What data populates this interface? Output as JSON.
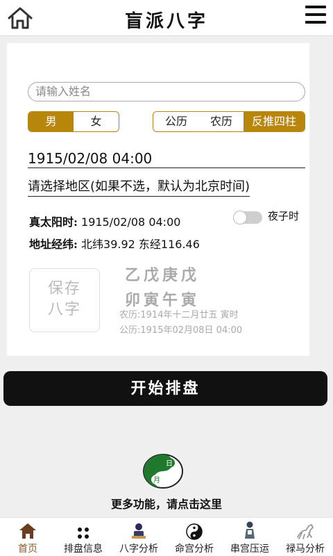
{
  "header": {
    "title": "盲派八字",
    "home_icon": "home-icon",
    "menu_icon": "menu-icon"
  },
  "form": {
    "name_placeholder": "请输入姓名",
    "gender_options": [
      "男",
      "女"
    ],
    "gender_selected": "男",
    "calendar_options": [
      "公历",
      "农历",
      "反推四柱"
    ],
    "calendar_selected": "反推四柱",
    "datetime": "1915/02/08 04:00",
    "region_prompt": "请选择地区(如果不选，默认为北京时间)"
  },
  "info": {
    "solar_label": "真太阳时:",
    "solar_value": "1915/02/08 04:00",
    "night_label": "夜子时",
    "night_toggle_on": false,
    "addr_label": "地址经纬:",
    "addr_value": "北纬39.92 东经116.46"
  },
  "save": {
    "line1": "保存",
    "line2": "八字"
  },
  "bazi": {
    "stems": "乙戊庚戊",
    "branches": "卯寅午寅",
    "lunar": "农历:1914年十二月廿五  寅时",
    "solar": "公历:1915年02月08日 04:00"
  },
  "start_button": "开始排盘",
  "more": {
    "logo_sun": "日",
    "logo_moon": "月",
    "text": "更多功能，请点击这里"
  },
  "tabs": [
    {
      "label": "首页",
      "icon": "house-icon",
      "active": true
    },
    {
      "label": "排盘信息",
      "icon": "dots-icon",
      "active": false
    },
    {
      "label": "八字分析",
      "icon": "scholar-icon",
      "active": false
    },
    {
      "label": "命宫分析",
      "icon": "yin-yang-icon",
      "active": false
    },
    {
      "label": "串宫压运",
      "icon": "figure-icon",
      "active": false
    },
    {
      "label": "禄马分析",
      "icon": "horse-icon",
      "active": false
    }
  ],
  "colors": {
    "accent": "#b8860b",
    "tab_active": "#8b5a2b",
    "button_bg": "#111111"
  }
}
